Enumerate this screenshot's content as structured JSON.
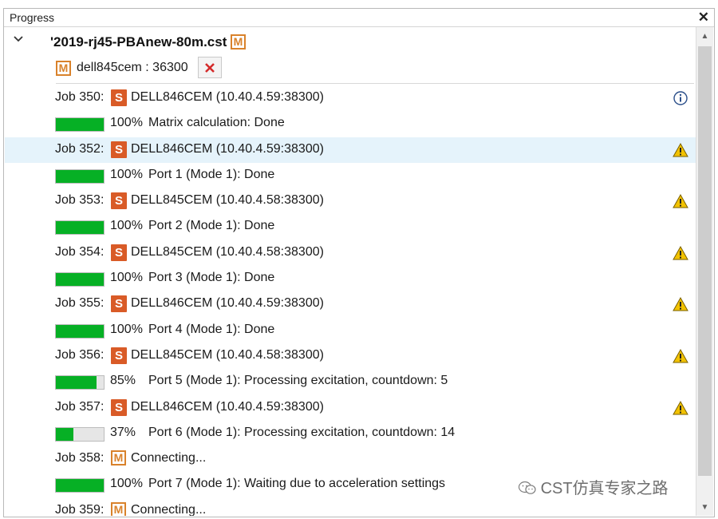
{
  "panel": {
    "title": "Progress"
  },
  "project": {
    "name": "'2019-rj45-PBAnew-80m.cst",
    "icon": "m-orange-icon"
  },
  "node": {
    "label": "dell845cem : 36300",
    "kill_icon": "red-x-icon"
  },
  "rows": [
    {
      "kind": "job",
      "label": "Job 350:",
      "server": "DELL846CEM (10.40.4.59:38300)",
      "server_icon": "s-icon",
      "status_icon": "info-icon"
    },
    {
      "kind": "progress",
      "percent": 100,
      "percent_text": "100%",
      "message": "Matrix calculation: Done"
    },
    {
      "kind": "job",
      "label": "Job 352:",
      "server": "DELL846CEM (10.40.4.59:38300)",
      "server_icon": "s-icon",
      "status_icon": "warning-icon",
      "selected": true
    },
    {
      "kind": "progress",
      "percent": 100,
      "percent_text": "100%",
      "message": "Port 1 (Mode 1): Done"
    },
    {
      "kind": "job",
      "label": "Job 353:",
      "server": "DELL845CEM (10.40.4.58:38300)",
      "server_icon": "s-icon",
      "status_icon": "warning-icon"
    },
    {
      "kind": "progress",
      "percent": 100,
      "percent_text": "100%",
      "message": "Port 2 (Mode 1): Done"
    },
    {
      "kind": "job",
      "label": "Job 354:",
      "server": "DELL845CEM (10.40.4.58:38300)",
      "server_icon": "s-icon",
      "status_icon": "warning-icon"
    },
    {
      "kind": "progress",
      "percent": 100,
      "percent_text": "100%",
      "message": "Port 3 (Mode 1): Done"
    },
    {
      "kind": "job",
      "label": "Job 355:",
      "server": "DELL846CEM (10.40.4.59:38300)",
      "server_icon": "s-icon",
      "status_icon": "warning-icon"
    },
    {
      "kind": "progress",
      "percent": 100,
      "percent_text": "100%",
      "message": "Port 4 (Mode 1): Done"
    },
    {
      "kind": "job",
      "label": "Job 356:",
      "server": "DELL845CEM (10.40.4.58:38300)",
      "server_icon": "s-icon",
      "status_icon": "warning-icon"
    },
    {
      "kind": "progress",
      "percent": 85,
      "percent_text": "85%",
      "message": "Port 5 (Mode 1): Processing excitation, countdown: 5"
    },
    {
      "kind": "job",
      "label": "Job 357:",
      "server": "DELL846CEM (10.40.4.59:38300)",
      "server_icon": "s-icon",
      "status_icon": "warning-icon"
    },
    {
      "kind": "progress",
      "percent": 37,
      "percent_text": "37%",
      "message": "Port 6 (Mode 1): Processing excitation, countdown: 14"
    },
    {
      "kind": "job",
      "label": "Job 358:",
      "server": "Connecting...",
      "server_icon": "m-icon",
      "status_icon": ""
    },
    {
      "kind": "progress",
      "percent": 100,
      "percent_text": "100%",
      "message": "Port 7 (Mode 1): Waiting due to acceleration settings"
    },
    {
      "kind": "job",
      "label": "Job 359:",
      "server": "Connecting...",
      "server_icon": "m-icon",
      "status_icon": ""
    }
  ],
  "watermark": {
    "text": "CST仿真专家之路",
    "icon": "wechat-icon"
  },
  "colors": {
    "progress_fill": "#06b025",
    "selected_row": "#e5f3fb",
    "warning": "#f2c200",
    "m_icon": "#d9822b",
    "s_icon": "#d95b27"
  }
}
